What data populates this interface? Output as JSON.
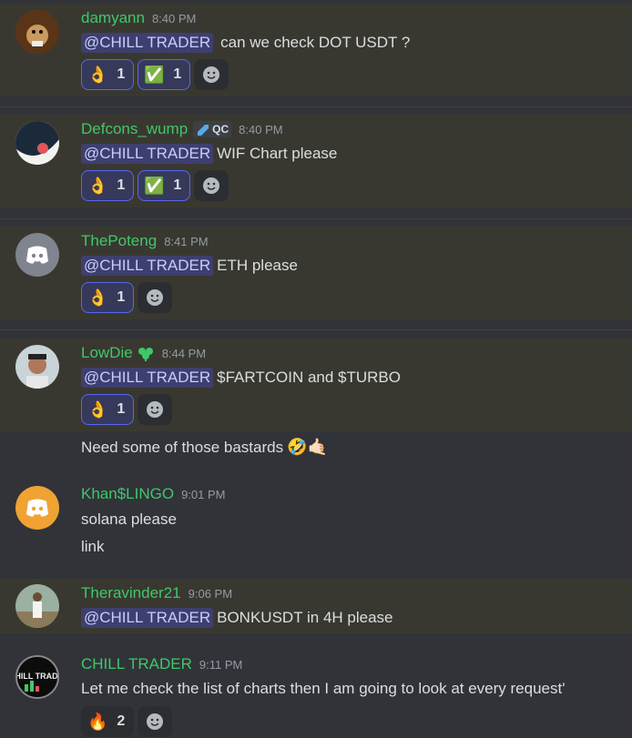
{
  "messages": [
    {
      "username": "damyann",
      "time": "8:40 PM",
      "mention": "@CHILL TRADER",
      "text": "can we check DOT USDT ?",
      "reactions": [
        {
          "emoji": "👌",
          "count": "1"
        },
        {
          "emoji": "✅",
          "count": "1"
        }
      ]
    },
    {
      "username": "Defcons_wump",
      "tag": "QC",
      "time": "8:40 PM",
      "mention": "@CHILL TRADER",
      "text": "WIF Chart please",
      "reactions": [
        {
          "emoji": "👌",
          "count": "1"
        },
        {
          "emoji": "✅",
          "count": "1"
        }
      ]
    },
    {
      "username": "ThePoteng",
      "time": "8:41 PM",
      "mention": "@CHILL TRADER",
      "text": "ETH please",
      "reactions": [
        {
          "emoji": "👌",
          "count": "1"
        }
      ]
    },
    {
      "username": "LowDie",
      "time": "8:44 PM",
      "mention": "@CHILL TRADER",
      "text": "$FARTCOIN and $TURBO",
      "reactions": [
        {
          "emoji": "👌",
          "count": "1"
        }
      ],
      "followup": "Need some of those bastards",
      "followup_emoji": "🤣🤙🏻"
    },
    {
      "username": "Khan$LINGO",
      "time": "9:01 PM",
      "text": "solana please",
      "text2": "link"
    },
    {
      "username": "Theravinder21",
      "time": "9:06 PM",
      "mention": "@CHILL TRADER",
      "text": "BONKUSDT in 4H please"
    },
    {
      "username": "CHILL TRADER",
      "time": "9:11 PM",
      "text": "Let me check the list of charts then I am going to look at every request'",
      "reactions": [
        {
          "emoji": "🔥",
          "count": "2"
        }
      ],
      "avatar_text": "CHILL TRADER"
    }
  ],
  "colors": {
    "username": "#3ec86a",
    "mention_bg": "#3d3f70",
    "highlight_bg": "#393830",
    "background": "#313338",
    "discord_blurple": "#5865f2",
    "khan_avatar": "#f0a232"
  },
  "icons": {
    "add_reaction": "smile-plus-icon",
    "discord_logo": "discord-logo-icon",
    "sprout_badge": "sprout-icon",
    "quality_tag": "chat-bubble-icon"
  }
}
